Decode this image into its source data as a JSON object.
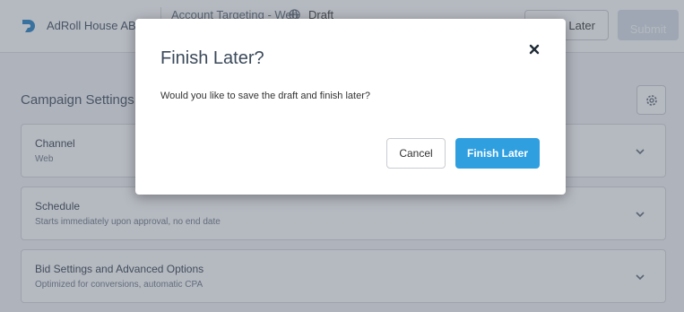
{
  "header": {
    "brand": "AdRoll House ABM",
    "campaign_name": "Account Targeting - Web",
    "status": "Draft",
    "finish_later_label": "Later",
    "submit_label": "Submit"
  },
  "main": {
    "section_title": "Campaign Settings",
    "cards": [
      {
        "title": "Channel",
        "subtitle": "Web"
      },
      {
        "title": "Schedule",
        "subtitle": "Starts immediately upon approval, no end date"
      },
      {
        "title": "Bid Settings and Advanced Options",
        "subtitle": "Optimized for conversions, automatic CPA"
      }
    ]
  },
  "modal": {
    "title": "Finish Later?",
    "message": "Would you like to save the draft and finish later?",
    "cancel_label": "Cancel",
    "confirm_label": "Finish Later"
  },
  "colors": {
    "primary": "#2f9fe0",
    "brand_logo": "#1f7fc4",
    "overlay": "rgba(90,100,115,0.45)"
  }
}
